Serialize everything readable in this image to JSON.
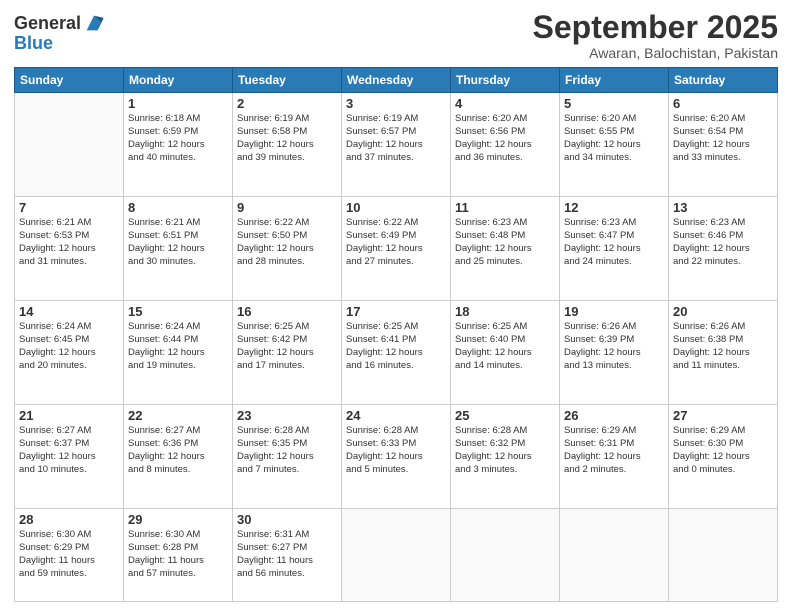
{
  "logo": {
    "general": "General",
    "blue": "Blue"
  },
  "header": {
    "month": "September 2025",
    "location": "Awaran, Balochistan, Pakistan"
  },
  "days_of_week": [
    "Sunday",
    "Monday",
    "Tuesday",
    "Wednesday",
    "Thursday",
    "Friday",
    "Saturday"
  ],
  "weeks": [
    [
      {
        "day": "",
        "info": ""
      },
      {
        "day": "1",
        "info": "Sunrise: 6:18 AM\nSunset: 6:59 PM\nDaylight: 12 hours\nand 40 minutes."
      },
      {
        "day": "2",
        "info": "Sunrise: 6:19 AM\nSunset: 6:58 PM\nDaylight: 12 hours\nand 39 minutes."
      },
      {
        "day": "3",
        "info": "Sunrise: 6:19 AM\nSunset: 6:57 PM\nDaylight: 12 hours\nand 37 minutes."
      },
      {
        "day": "4",
        "info": "Sunrise: 6:20 AM\nSunset: 6:56 PM\nDaylight: 12 hours\nand 36 minutes."
      },
      {
        "day": "5",
        "info": "Sunrise: 6:20 AM\nSunset: 6:55 PM\nDaylight: 12 hours\nand 34 minutes."
      },
      {
        "day": "6",
        "info": "Sunrise: 6:20 AM\nSunset: 6:54 PM\nDaylight: 12 hours\nand 33 minutes."
      }
    ],
    [
      {
        "day": "7",
        "info": "Sunrise: 6:21 AM\nSunset: 6:53 PM\nDaylight: 12 hours\nand 31 minutes."
      },
      {
        "day": "8",
        "info": "Sunrise: 6:21 AM\nSunset: 6:51 PM\nDaylight: 12 hours\nand 30 minutes."
      },
      {
        "day": "9",
        "info": "Sunrise: 6:22 AM\nSunset: 6:50 PM\nDaylight: 12 hours\nand 28 minutes."
      },
      {
        "day": "10",
        "info": "Sunrise: 6:22 AM\nSunset: 6:49 PM\nDaylight: 12 hours\nand 27 minutes."
      },
      {
        "day": "11",
        "info": "Sunrise: 6:23 AM\nSunset: 6:48 PM\nDaylight: 12 hours\nand 25 minutes."
      },
      {
        "day": "12",
        "info": "Sunrise: 6:23 AM\nSunset: 6:47 PM\nDaylight: 12 hours\nand 24 minutes."
      },
      {
        "day": "13",
        "info": "Sunrise: 6:23 AM\nSunset: 6:46 PM\nDaylight: 12 hours\nand 22 minutes."
      }
    ],
    [
      {
        "day": "14",
        "info": "Sunrise: 6:24 AM\nSunset: 6:45 PM\nDaylight: 12 hours\nand 20 minutes."
      },
      {
        "day": "15",
        "info": "Sunrise: 6:24 AM\nSunset: 6:44 PM\nDaylight: 12 hours\nand 19 minutes."
      },
      {
        "day": "16",
        "info": "Sunrise: 6:25 AM\nSunset: 6:42 PM\nDaylight: 12 hours\nand 17 minutes."
      },
      {
        "day": "17",
        "info": "Sunrise: 6:25 AM\nSunset: 6:41 PM\nDaylight: 12 hours\nand 16 minutes."
      },
      {
        "day": "18",
        "info": "Sunrise: 6:25 AM\nSunset: 6:40 PM\nDaylight: 12 hours\nand 14 minutes."
      },
      {
        "day": "19",
        "info": "Sunrise: 6:26 AM\nSunset: 6:39 PM\nDaylight: 12 hours\nand 13 minutes."
      },
      {
        "day": "20",
        "info": "Sunrise: 6:26 AM\nSunset: 6:38 PM\nDaylight: 12 hours\nand 11 minutes."
      }
    ],
    [
      {
        "day": "21",
        "info": "Sunrise: 6:27 AM\nSunset: 6:37 PM\nDaylight: 12 hours\nand 10 minutes."
      },
      {
        "day": "22",
        "info": "Sunrise: 6:27 AM\nSunset: 6:36 PM\nDaylight: 12 hours\nand 8 minutes."
      },
      {
        "day": "23",
        "info": "Sunrise: 6:28 AM\nSunset: 6:35 PM\nDaylight: 12 hours\nand 7 minutes."
      },
      {
        "day": "24",
        "info": "Sunrise: 6:28 AM\nSunset: 6:33 PM\nDaylight: 12 hours\nand 5 minutes."
      },
      {
        "day": "25",
        "info": "Sunrise: 6:28 AM\nSunset: 6:32 PM\nDaylight: 12 hours\nand 3 minutes."
      },
      {
        "day": "26",
        "info": "Sunrise: 6:29 AM\nSunset: 6:31 PM\nDaylight: 12 hours\nand 2 minutes."
      },
      {
        "day": "27",
        "info": "Sunrise: 6:29 AM\nSunset: 6:30 PM\nDaylight: 12 hours\nand 0 minutes."
      }
    ],
    [
      {
        "day": "28",
        "info": "Sunrise: 6:30 AM\nSunset: 6:29 PM\nDaylight: 11 hours\nand 59 minutes."
      },
      {
        "day": "29",
        "info": "Sunrise: 6:30 AM\nSunset: 6:28 PM\nDaylight: 11 hours\nand 57 minutes."
      },
      {
        "day": "30",
        "info": "Sunrise: 6:31 AM\nSunset: 6:27 PM\nDaylight: 11 hours\nand 56 minutes."
      },
      {
        "day": "",
        "info": ""
      },
      {
        "day": "",
        "info": ""
      },
      {
        "day": "",
        "info": ""
      },
      {
        "day": "",
        "info": ""
      }
    ]
  ]
}
